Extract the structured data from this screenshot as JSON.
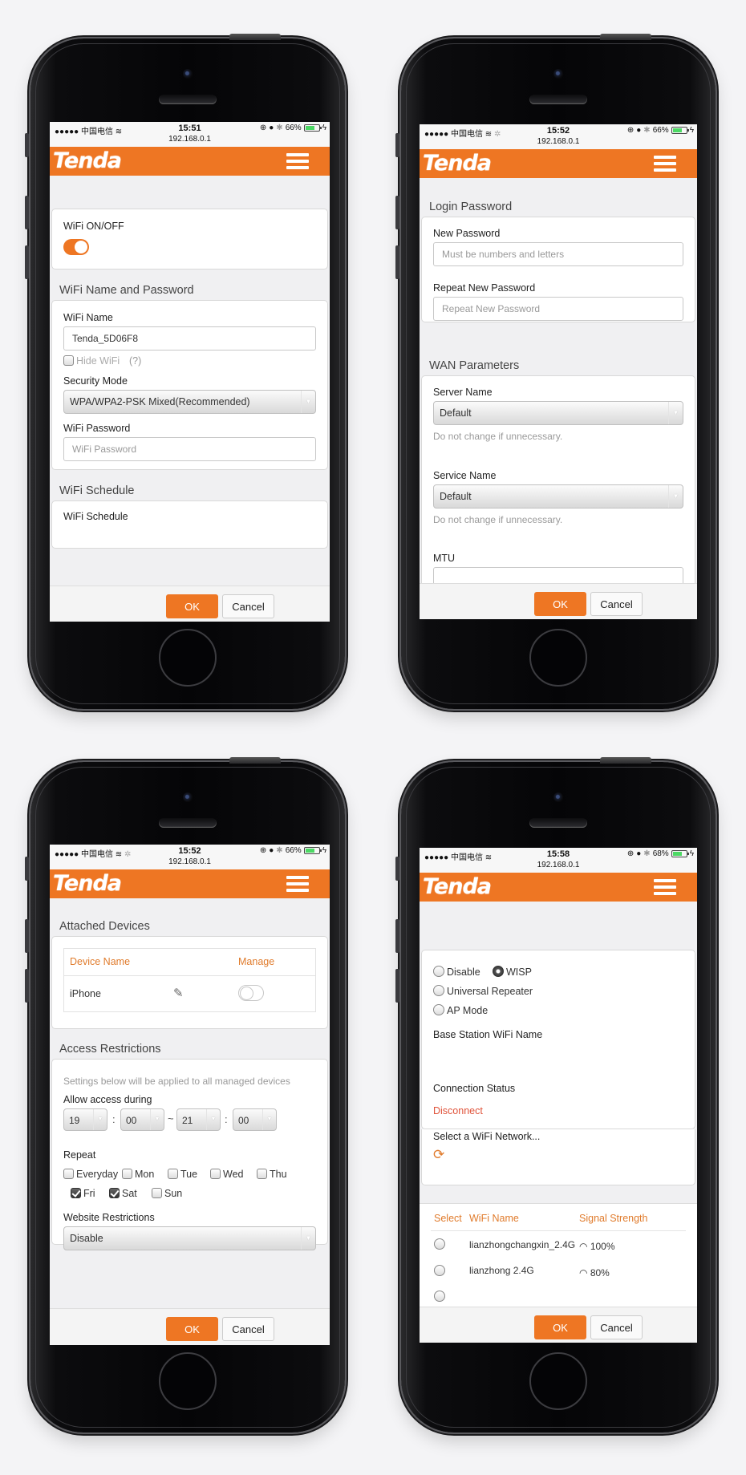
{
  "common": {
    "url": "192.168.0.1",
    "carrier": "●●●●● 中国电信",
    "brand": "Tenda",
    "brand_color": "#ee7623",
    "ok_label": "OK",
    "cancel_label": "Cancel"
  },
  "screens": [
    {
      "status": {
        "time": "15:51",
        "battery": "66%",
        "battery_level": 0.66
      },
      "wifi_toggle": {
        "label": "WiFi ON/OFF",
        "state": "on"
      },
      "wifi_name_password": {
        "title": "WiFi Name and Password",
        "wifi_name_label": "WiFi Name",
        "wifi_name_value": "Tenda_5D06F8",
        "hide_wifi_label": "Hide WiFi",
        "hide_wifi_checked": false,
        "help_label": "(?)",
        "security_mode_label": "Security Mode",
        "security_mode_value": "WPA/WPA2-PSK Mixed(Recommended)",
        "wifi_password_label": "WiFi Password",
        "wifi_password_placeholder": "WiFi Password"
      },
      "wifi_schedule": {
        "title": "WiFi Schedule",
        "label": "WiFi Schedule"
      }
    },
    {
      "status": {
        "time": "15:52",
        "battery": "66%",
        "battery_level": 0.66
      },
      "login_password": {
        "title": "Login Password",
        "new_password_label": "New Password",
        "new_password_placeholder": "Must be numbers and letters",
        "repeat_label": "Repeat New Password",
        "repeat_placeholder": "Repeat New Password"
      },
      "wan_parameters": {
        "title": "WAN Parameters",
        "server_name_label": "Server Name",
        "server_name_value": "Default",
        "server_hint": "Do not change if unnecessary.",
        "service_name_label": "Service Name",
        "service_name_value": "Default",
        "service_hint": "Do not change if unnecessary.",
        "mtu_label": "MTU"
      }
    },
    {
      "status": {
        "time": "15:52",
        "battery": "66%",
        "battery_level": 0.66
      },
      "attached_devices": {
        "title": "Attached Devices",
        "col_device": "Device Name",
        "col_manage": "Manage",
        "rows": [
          {
            "name": "iPhone",
            "managed": false
          }
        ]
      },
      "access_restrictions": {
        "title": "Access Restrictions",
        "note": "Settings below will be applied to all managed devices",
        "allow_label": "Allow access during",
        "start_hour": "19",
        "start_min": "00",
        "end_hour": "21",
        "end_min": "00",
        "colon": ":",
        "tilde": "~",
        "repeat_label": "Repeat",
        "days": [
          {
            "label": "Everyday",
            "checked": false
          },
          {
            "label": "Mon",
            "checked": false
          },
          {
            "label": "Tue",
            "checked": false
          },
          {
            "label": "Wed",
            "checked": false
          },
          {
            "label": "Thu",
            "checked": false
          },
          {
            "label": "Fri",
            "checked": true
          },
          {
            "label": "Sat",
            "checked": true
          },
          {
            "label": "Sun",
            "checked": false
          }
        ],
        "website_label": "Website Restrictions",
        "website_value": "Disable"
      }
    },
    {
      "status": {
        "time": "15:58",
        "battery": "68%",
        "battery_level": 0.68
      },
      "mode": {
        "options": [
          {
            "label": "Disable",
            "checked": false
          },
          {
            "label": "WISP",
            "checked": true
          },
          {
            "label": "Universal Repeater",
            "checked": false
          },
          {
            "label": "AP Mode",
            "checked": false
          }
        ],
        "base_station_label": "Base Station WiFi Name",
        "connection_status_label": "Connection Status",
        "connection_status_value": "Disconnect",
        "connection_status_color": "#e0533a",
        "select_network_label": "Select a WiFi Network..."
      },
      "network_table": {
        "col_select": "Select",
        "col_name": "WiFi Name",
        "col_signal": "Signal Strength",
        "rows": [
          {
            "name": "lianzhongchangxin_2.4G",
            "signal": "100%"
          },
          {
            "name": "lianzhong 2.4G",
            "signal": "80%"
          }
        ]
      }
    }
  ]
}
